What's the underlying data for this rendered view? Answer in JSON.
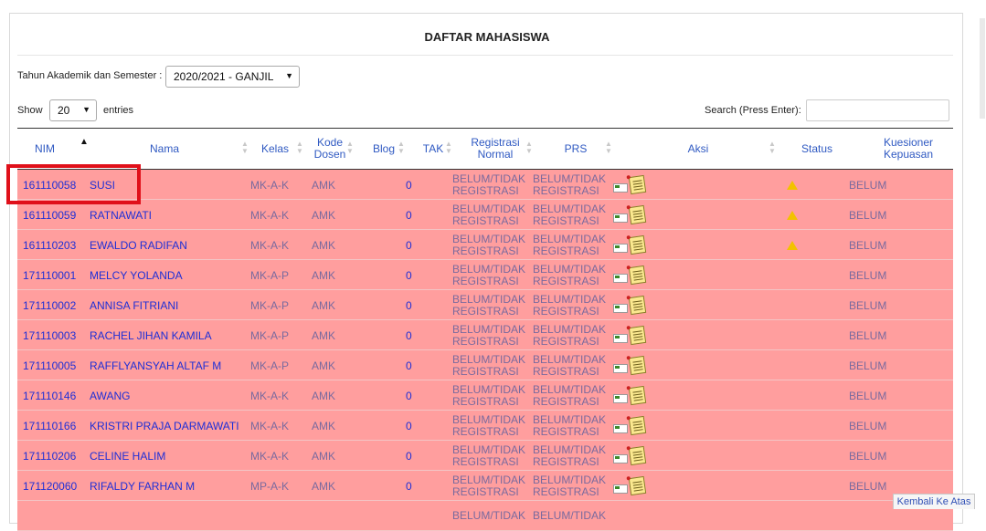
{
  "title": "DAFTAR MAHASISWA",
  "semester": {
    "label": "Tahun Akademik dan Semester :",
    "value": "2020/2021 - GANJIL"
  },
  "length": {
    "show_label": "Show",
    "value": "20",
    "entries_label": "entries"
  },
  "search": {
    "label": "Search (Press Enter):",
    "value": ""
  },
  "columns": {
    "nim": "NIM",
    "nama": "Nama",
    "kelas": "Kelas",
    "kode_dosen": "Kode Dosen",
    "blog": "Blog",
    "tak": "TAK",
    "registrasi_normal": "Registrasi Normal",
    "prs": "PRS",
    "aksi": "Aksi",
    "status": "Status",
    "kuesioner": "Kuesioner Kepuasan"
  },
  "sort": {
    "active_column": "NIM",
    "direction": "ascending"
  },
  "rows": [
    {
      "nim": "161110058",
      "nama": "SUSI",
      "kelas": "MK-A-K",
      "kode": "AMK",
      "tak": "0",
      "reg": "BELUM/TIDAK REGISTRASI",
      "prs": "BELUM/TIDAK REGISTRASI",
      "warning": true,
      "kues": "BELUM"
    },
    {
      "nim": "161110059",
      "nama": "RATNAWATI",
      "kelas": "MK-A-K",
      "kode": "AMK",
      "tak": "0",
      "reg": "BELUM/TIDAK REGISTRASI",
      "prs": "BELUM/TIDAK REGISTRASI",
      "warning": true,
      "kues": "BELUM"
    },
    {
      "nim": "161110203",
      "nama": "EWALDO RADIFAN",
      "kelas": "MK-A-K",
      "kode": "AMK",
      "tak": "0",
      "reg": "BELUM/TIDAK REGISTRASI",
      "prs": "BELUM/TIDAK REGISTRASI",
      "warning": true,
      "kues": "BELUM"
    },
    {
      "nim": "171110001",
      "nama": "MELCY YOLANDA",
      "kelas": "MK-A-P",
      "kode": "AMK",
      "tak": "0",
      "reg": "BELUM/TIDAK REGISTRASI",
      "prs": "BELUM/TIDAK REGISTRASI",
      "warning": false,
      "kues": "BELUM"
    },
    {
      "nim": "171110002",
      "nama": "ANNISA FITRIANI",
      "kelas": "MK-A-P",
      "kode": "AMK",
      "tak": "0",
      "reg": "BELUM/TIDAK REGISTRASI",
      "prs": "BELUM/TIDAK REGISTRASI",
      "warning": false,
      "kues": "BELUM"
    },
    {
      "nim": "171110003",
      "nama": "RACHEL JIHAN KAMILA",
      "kelas": "MK-A-P",
      "kode": "AMK",
      "tak": "0",
      "reg": "BELUM/TIDAK REGISTRASI",
      "prs": "BELUM/TIDAK REGISTRASI",
      "warning": false,
      "kues": "BELUM"
    },
    {
      "nim": "171110005",
      "nama": "RAFFLYANSYAH ALTAF M",
      "kelas": "MK-A-P",
      "kode": "AMK",
      "tak": "0",
      "reg": "BELUM/TIDAK REGISTRASI",
      "prs": "BELUM/TIDAK REGISTRASI",
      "warning": false,
      "kues": "BELUM"
    },
    {
      "nim": "171110146",
      "nama": "AWANG",
      "kelas": "MK-A-K",
      "kode": "AMK",
      "tak": "0",
      "reg": "BELUM/TIDAK REGISTRASI",
      "prs": "BELUM/TIDAK REGISTRASI",
      "warning": false,
      "kues": "BELUM"
    },
    {
      "nim": "171110166",
      "nama": "KRISTRI PRAJA DARMAWATI",
      "kelas": "MK-A-K",
      "kode": "AMK",
      "tak": "0",
      "reg": "BELUM/TIDAK REGISTRASI",
      "prs": "BELUM/TIDAK REGISTRASI",
      "warning": false,
      "kues": "BELUM"
    },
    {
      "nim": "171110206",
      "nama": "CELINE HALIM",
      "kelas": "MK-A-K",
      "kode": "AMK",
      "tak": "0",
      "reg": "BELUM/TIDAK REGISTRASI",
      "prs": "BELUM/TIDAK REGISTRASI",
      "warning": false,
      "kues": "BELUM"
    },
    {
      "nim": "171120060",
      "nama": "RIFALDY FARHAN M",
      "kelas": "MP-A-K",
      "kode": "AMK",
      "tak": "0",
      "reg": "BELUM/TIDAK REGISTRASI",
      "prs": "BELUM/TIDAK REGISTRASI",
      "warning": false,
      "kues": "BELUM"
    },
    {
      "nim": "",
      "nama": "",
      "kelas": "",
      "kode": "",
      "tak": "",
      "reg": "BELUM/TIDAK",
      "prs": "BELUM/TIDAK",
      "warning": false,
      "kues": ""
    }
  ],
  "back_to_top": "Kembali Ke Atas",
  "colors": {
    "row_bg": "#ff9e9e",
    "link": "#1f2fd6",
    "header": "#2f59c2",
    "highlight": "#e0101a"
  },
  "icons": [
    "add-card-icon",
    "notes-icon",
    "warning-icon",
    "sort-ascending-icon"
  ]
}
